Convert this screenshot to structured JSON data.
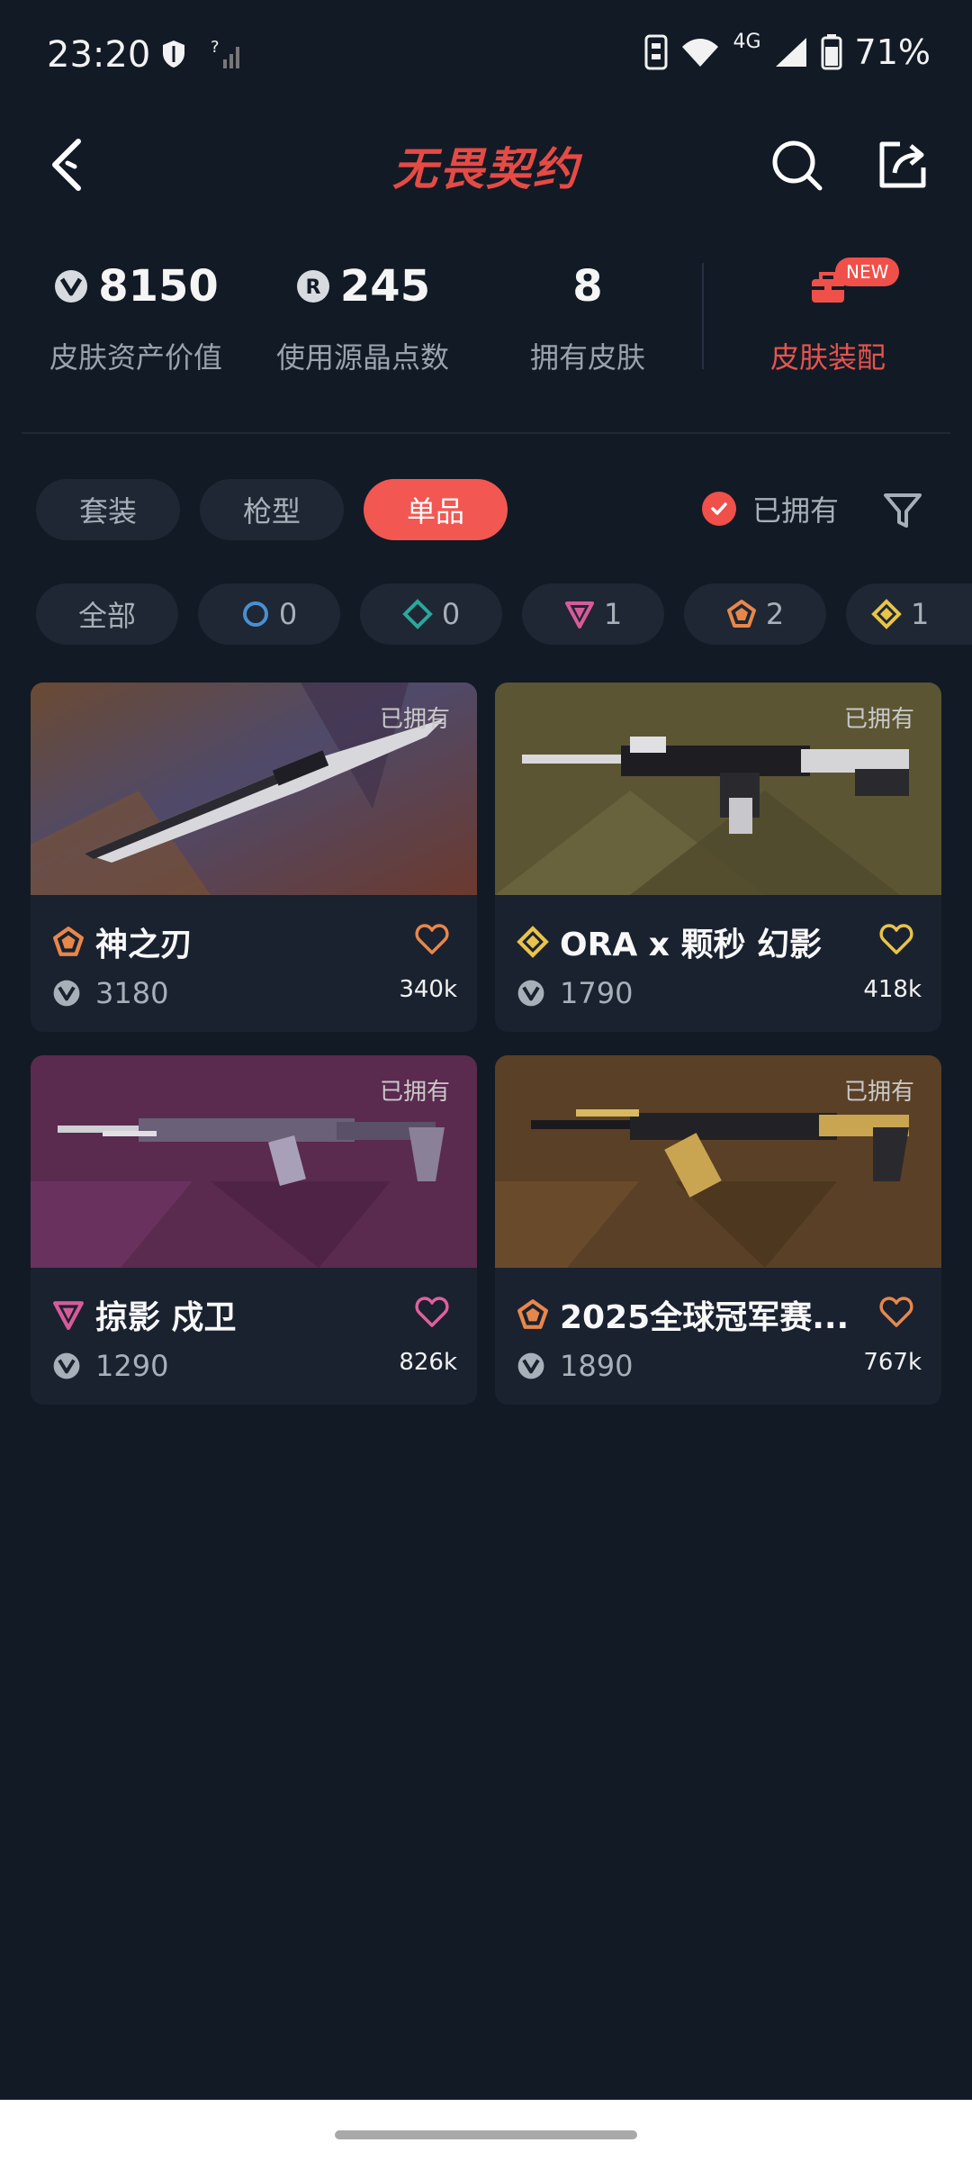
{
  "status": {
    "time": "23:20",
    "battery": "71%",
    "network": "4G"
  },
  "header": {
    "title": "无畏契约"
  },
  "stats": {
    "asset_value": "8150",
    "asset_value_label": "皮肤资产价值",
    "radianite": "245",
    "radianite_label": "使用源晶点数",
    "owned_count": "8",
    "owned_count_label": "拥有皮肤",
    "loadout_label": "皮肤装配",
    "new_badge": "NEW"
  },
  "tabs": [
    "套装",
    "枪型",
    "单品"
  ],
  "owned_filter_label": "已拥有",
  "tiers": {
    "all": "全部",
    "counts": [
      "0",
      "0",
      "1",
      "2",
      "1"
    ]
  },
  "colors": {
    "accent": "#f25752",
    "background": "#121a25",
    "card": "#1a2230"
  },
  "cards": [
    {
      "title": "神之刃",
      "price": "3180",
      "likes": "340k",
      "owned": "已拥有",
      "tier_icon": "select-tier-icon",
      "heart_color": "#e8874a"
    },
    {
      "title": "ORA x 颗秒 幻影",
      "price": "1790",
      "likes": "418k",
      "owned": "已拥有",
      "tier_icon": "exclusive-tier-icon",
      "heart_color": "#e8c44a"
    },
    {
      "title": "掠影 戍卫",
      "price": "1290",
      "likes": "826k",
      "owned": "已拥有",
      "tier_icon": "premium-tier-icon",
      "heart_color": "#e0609e"
    },
    {
      "title": "2025全球冠军赛...",
      "price": "1890",
      "likes": "767k",
      "owned": "已拥有",
      "tier_icon": "select-tier-icon",
      "heart_color": "#e8874a"
    }
  ]
}
